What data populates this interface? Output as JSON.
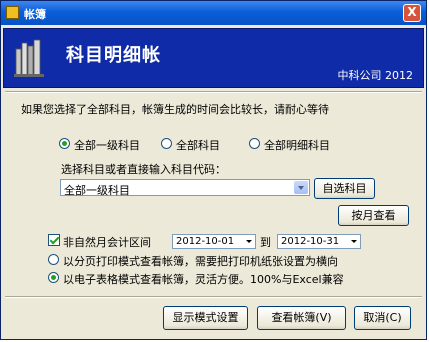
{
  "window": {
    "title": "帐簿",
    "close_label": "X"
  },
  "banner": {
    "heading": "科目明细帐",
    "company": "中科公司 2012"
  },
  "notice": "如果您选择了全部科目，帐簿生成的时间会比较长，请耐心等待",
  "scope_options": [
    {
      "label": "全部一级科目",
      "selected": true
    },
    {
      "label": "全部科目",
      "selected": false
    },
    {
      "label": "全部明细科目",
      "selected": false
    }
  ],
  "account_select": {
    "prompt": "选择科目或者直接输入科目代码：",
    "value": "全部一级科目"
  },
  "buttons": {
    "choose_account": "自选科目",
    "by_month": "按月查看",
    "display_settings": "显示模式设置",
    "view_ledger": "查看帐簿(V)",
    "cancel": "取消(C)"
  },
  "period": {
    "checkbox_label": "非自然月会计区间",
    "checked": true,
    "start_date": "2012-10-01",
    "to_label": "到",
    "end_date": "2012-10-31"
  },
  "mode_options": [
    {
      "label": "以分页打印模式查看帐簿，需要把打印机纸张设置为横向",
      "selected": false
    },
    {
      "label": "以电子表格模式查看帐簿，灵活方便。100%与Excel兼容",
      "selected": true
    }
  ]
}
